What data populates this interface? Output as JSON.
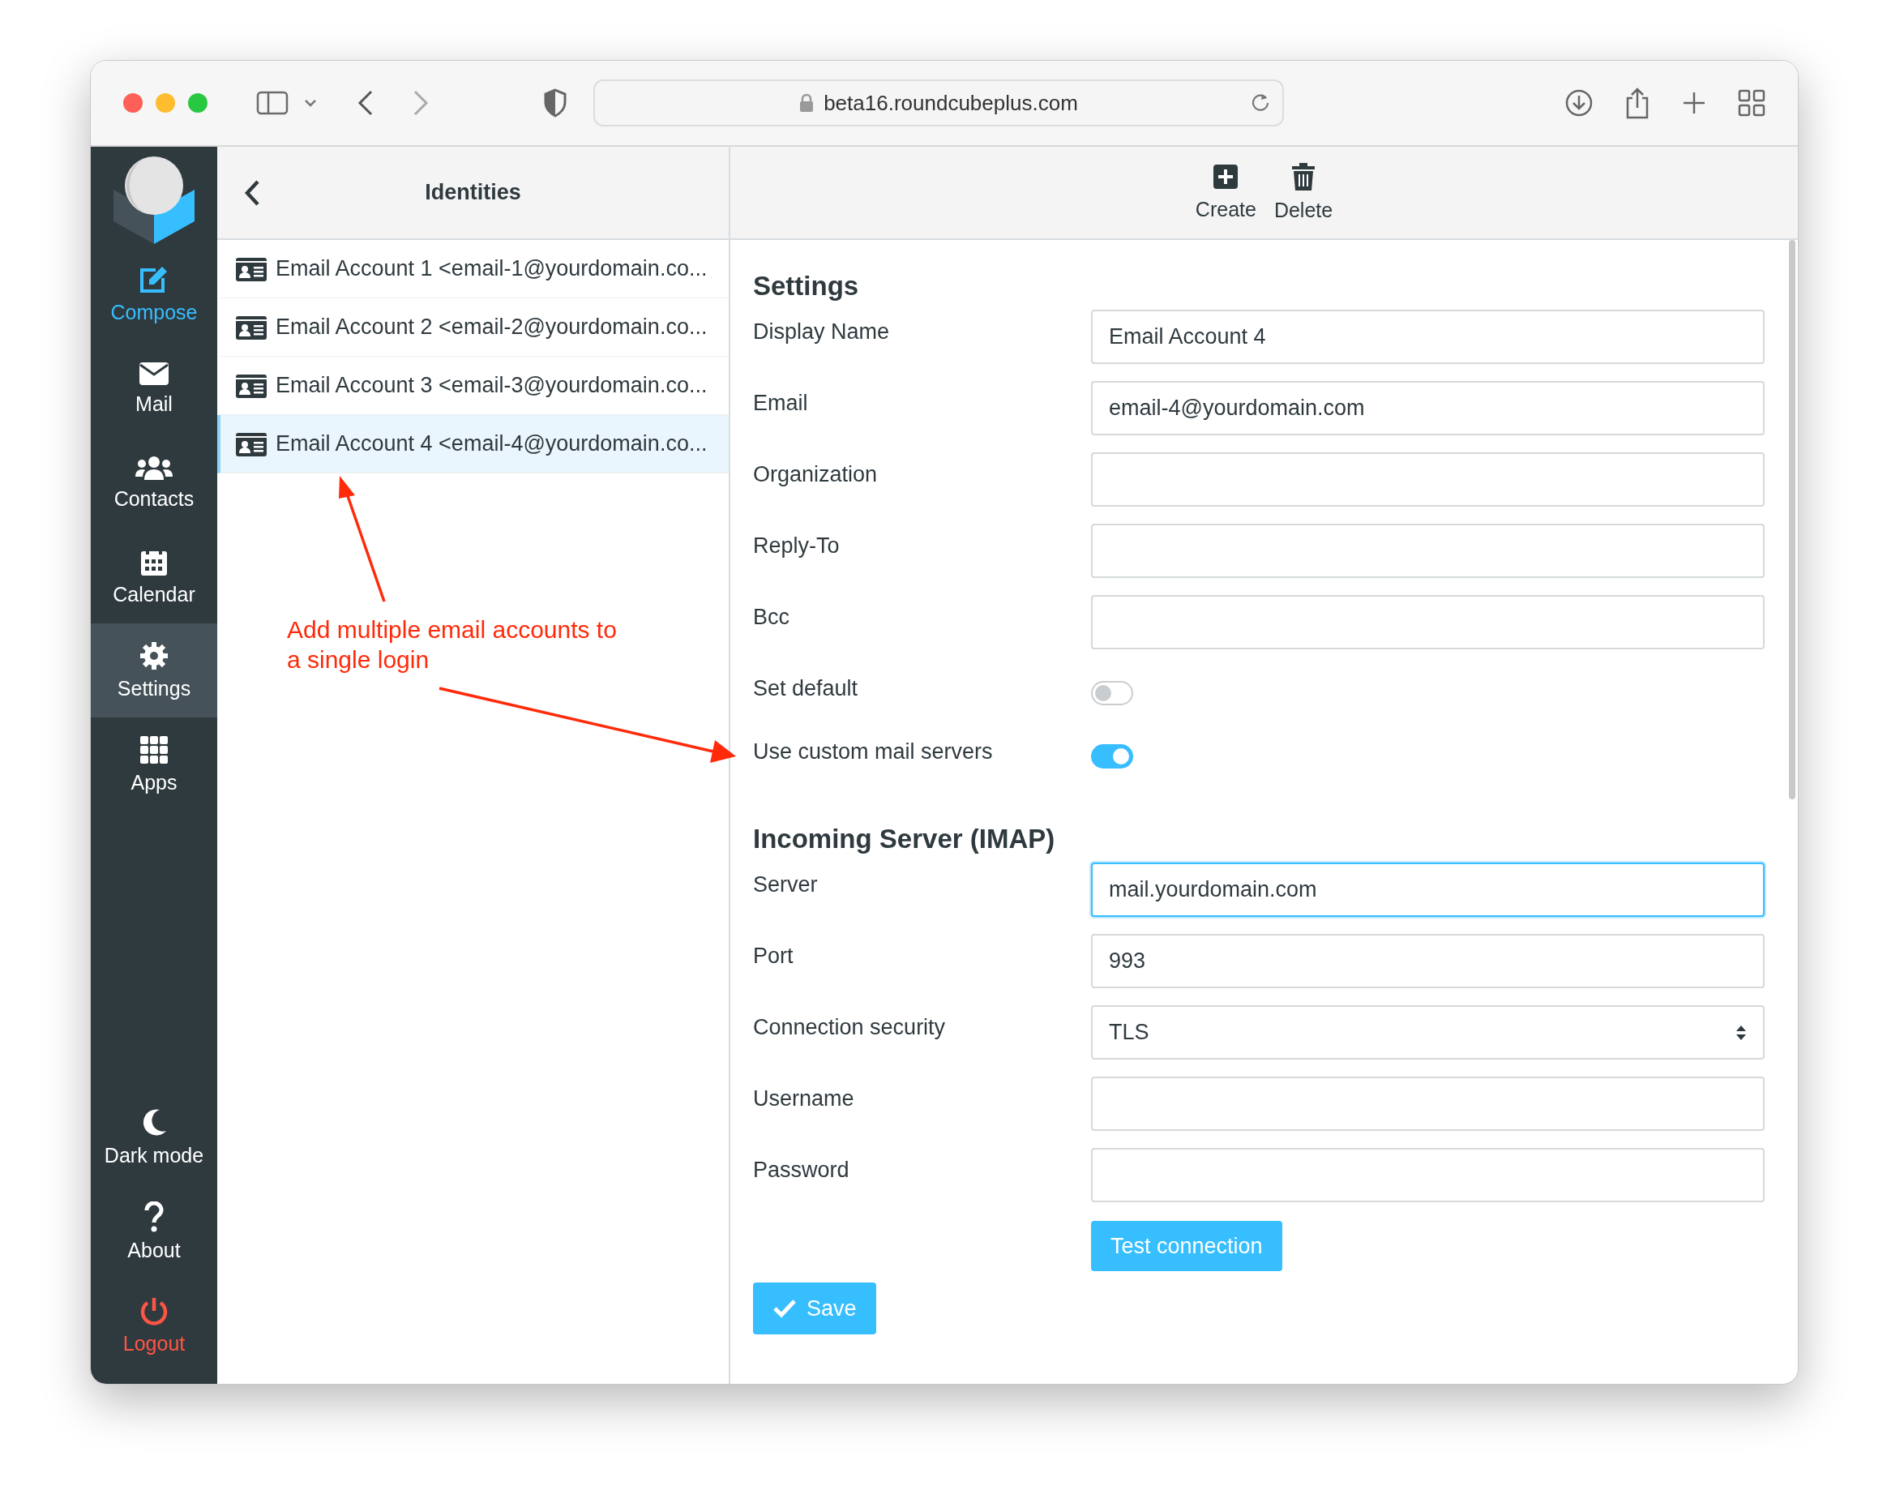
{
  "browser": {
    "address": "beta16.roundcubeplus.com"
  },
  "nav": {
    "top": [
      {
        "label": "Compose",
        "kind": "compose",
        "selected": false
      },
      {
        "label": "Mail",
        "kind": "mail",
        "selected": false
      },
      {
        "label": "Contacts",
        "kind": "contacts",
        "selected": false
      },
      {
        "label": "Calendar",
        "kind": "calendar",
        "selected": false
      },
      {
        "label": "Settings",
        "kind": "settings",
        "selected": true
      },
      {
        "label": "Apps",
        "kind": "apps",
        "selected": false
      }
    ],
    "bottom": [
      {
        "label": "Dark mode",
        "kind": "moon"
      },
      {
        "label": "About",
        "kind": "about"
      },
      {
        "label": "Logout",
        "kind": "logout"
      }
    ]
  },
  "identities": {
    "title": "Identities",
    "items": [
      {
        "label": "Email Account 1 <email-1@yourdomain.co...",
        "selected": false
      },
      {
        "label": "Email Account 2 <email-2@yourdomain.co...",
        "selected": false
      },
      {
        "label": "Email Account 3 <email-3@yourdomain.co...",
        "selected": false
      },
      {
        "label": "Email Account 4 <email-4@yourdomain.co...",
        "selected": true
      }
    ]
  },
  "toolbar": [
    {
      "label": "Create",
      "kind": "create"
    },
    {
      "label": "Delete",
      "kind": "delete"
    }
  ],
  "sections": [
    {
      "title": "Settings",
      "fields": [
        {
          "label": "Display Name",
          "kind": "text",
          "value": "Email Account 4",
          "focused": false
        },
        {
          "label": "Email",
          "kind": "text",
          "value": "email-4@yourdomain.com",
          "focused": false
        },
        {
          "label": "Organization",
          "kind": "text",
          "focused": false
        },
        {
          "label": "Reply-To",
          "kind": "text",
          "focused": false
        },
        {
          "label": "Bcc",
          "kind": "text",
          "focused": false
        },
        {
          "label": "Set default",
          "kind": "toggle",
          "on": false
        },
        {
          "label": "Use custom mail servers",
          "kind": "toggle",
          "on": true
        }
      ]
    },
    {
      "title": "Incoming Server (IMAP)",
      "fields": [
        {
          "label": "Server",
          "kind": "text",
          "value": "mail.yourdomain.com",
          "focused": true
        },
        {
          "label": "Port",
          "kind": "text",
          "value": "993",
          "focused": false
        },
        {
          "label": "Connection security",
          "kind": "select",
          "value": "TLS"
        },
        {
          "label": "Username",
          "kind": "text",
          "focused": false
        },
        {
          "label": "Password",
          "kind": "text",
          "focused": false
        },
        {
          "label": "Test connection",
          "kind": "button"
        }
      ]
    }
  ],
  "save": "Save",
  "annotation": "Add multiple email accounts to a single login"
}
